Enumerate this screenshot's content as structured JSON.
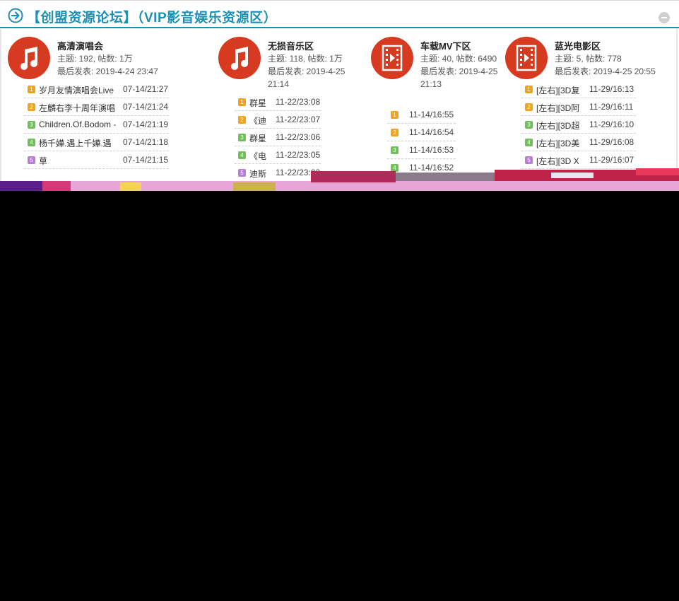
{
  "header": {
    "title": "【创盟资源论坛】（VIP影音娱乐资源区）"
  },
  "forums": [
    {
      "name": "高清演唱会",
      "icon": "music-note-icon",
      "topics": "主题: 192, 帖数: 1万",
      "last": "最后发表: 2019-4-24 23:47",
      "threads": [
        {
          "n": "1",
          "title": "岁月友情演唱会Live",
          "time": "07-14/21:27"
        },
        {
          "n": "2",
          "title": "左麟右李十周年演唱",
          "time": "07-14/21:24"
        },
        {
          "n": "3",
          "title": "Children.Of.Bodom -",
          "time": "07-14/21:19"
        },
        {
          "n": "4",
          "title": "杨千嬅.遇上千嬅.遇",
          "time": "07-14/21:18"
        },
        {
          "n": "5",
          "title": "草",
          "time": "07-14/21:15"
        }
      ]
    },
    {
      "name": "无损音乐区",
      "icon": "music-note-icon",
      "topics": "主题: 118, 帖数: 1万",
      "last": "最后发表: 2019-4-25 21:14",
      "threads": [
        {
          "n": "1",
          "title": "群星",
          "time": "11-22/23:08"
        },
        {
          "n": "2",
          "title": "《迪",
          "time": "11-22/23:07"
        },
        {
          "n": "3",
          "title": "群星",
          "time": "11-22/23:06"
        },
        {
          "n": "4",
          "title": "《电",
          "time": "11-22/23:05"
        },
        {
          "n": "5",
          "title": "迪斯",
          "time": "11-22/23:03"
        }
      ]
    },
    {
      "name": "车载MV下区",
      "icon": "video-film-icon",
      "topics": "主题: 40, 帖数: 6490",
      "last": "最后发表: 2019-4-25 21:13",
      "threads": [
        {
          "n": "1",
          "title": "",
          "time": "11-14/16:55"
        },
        {
          "n": "2",
          "title": "",
          "time": "11-14/16:54"
        },
        {
          "n": "3",
          "title": "",
          "time": "11-14/16:53"
        },
        {
          "n": "4",
          "title": "",
          "time": "11-14/16:52"
        }
      ]
    },
    {
      "name": "蓝光电影区",
      "icon": "video-film-icon",
      "topics": "主题: 5, 帖数: 778",
      "last": "最后发表: 2019-4-25 20:55",
      "threads": [
        {
          "n": "1",
          "title": "[左右][3D复",
          "time": "11-29/16:13"
        },
        {
          "n": "2",
          "title": "[左右][3D阿",
          "time": "11-29/16:11"
        },
        {
          "n": "3",
          "title": "[左右][3D超",
          "time": "11-29/16:10"
        },
        {
          "n": "4",
          "title": "[左右][3D美",
          "time": "11-29/16:08"
        },
        {
          "n": "5",
          "title": "[左右][3D X",
          "time": "11-29/16:07"
        }
      ]
    }
  ],
  "colors": {
    "accent": "#1e8fb4",
    "icon_bg": "#d63b21"
  }
}
